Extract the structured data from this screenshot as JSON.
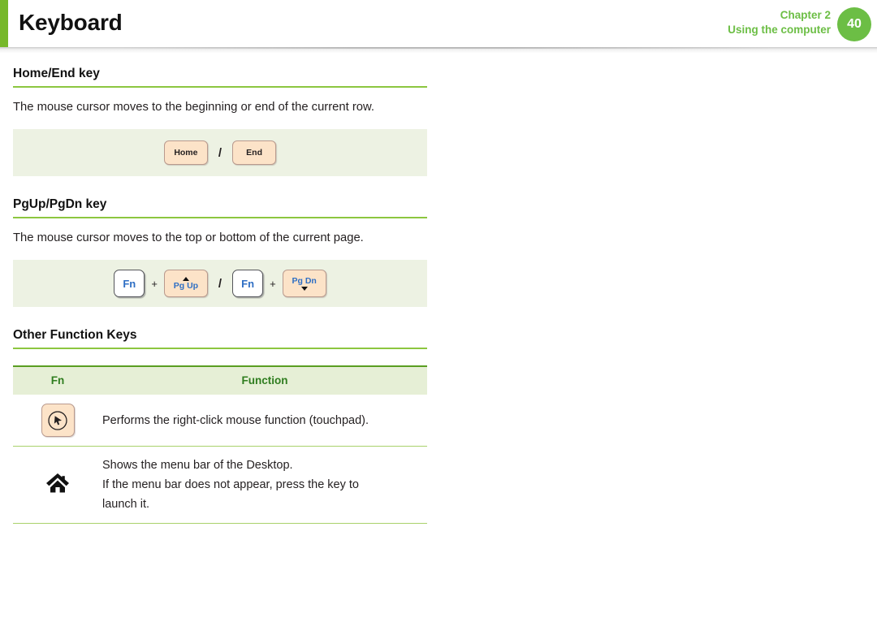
{
  "header": {
    "title": "Keyboard",
    "chapter": "Chapter 2",
    "chapter_subtitle": "Using the computer",
    "page_number": "40",
    "accent_color": "#76b82a",
    "badge_color": "#6cbe45"
  },
  "sections": [
    {
      "heading": "Home/End key",
      "body": "The mouse cursor moves to the beginning or end of the current row.",
      "keys": {
        "separator": "/",
        "left": {
          "label": "Home"
        },
        "right": {
          "label": "End"
        }
      }
    },
    {
      "heading": "PgUp/PgDn key",
      "body": "The mouse cursor moves to the top or bottom of the current page.",
      "keys": {
        "separator": "/",
        "plus": "+",
        "fn_label": "Fn",
        "left": {
          "line1": "Pg Up",
          "arrow": "up"
        },
        "right": {
          "line1": "Pg Dn",
          "arrow": "down"
        }
      }
    },
    {
      "heading": "Other Function Keys"
    }
  ],
  "table": {
    "columns": [
      "Fn",
      "Function"
    ],
    "rows": [
      {
        "icon": "right-click-key-icon",
        "lines": [
          "Performs the right-click mouse function (touchpad)."
        ]
      },
      {
        "icon": "home-menu-bar-icon",
        "lines": [
          "Shows the menu bar of the Desktop.",
          "If the menu bar does not appear, press the key to",
          "launch it."
        ]
      }
    ]
  },
  "colors": {
    "green_accent": "#8cc63f",
    "panel_bg": "#edf2e3",
    "table_header_bg": "#e6efd6",
    "table_header_text": "#2f7d1f",
    "keycap_bg": "#fce3c8",
    "key_text_blue": "#2f6fc4"
  }
}
